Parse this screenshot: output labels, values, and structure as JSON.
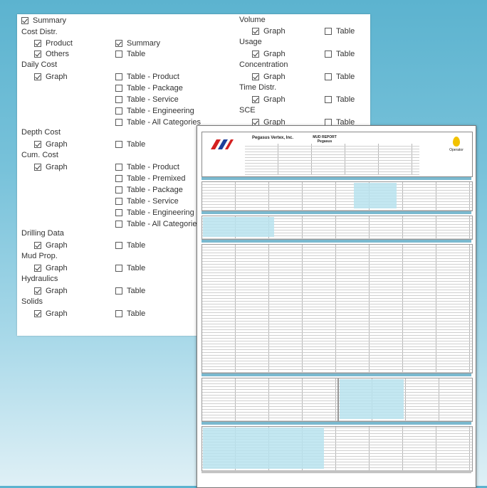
{
  "options": {
    "top_summary": {
      "label": "Summary",
      "checked": true
    },
    "cost_distr": {
      "title": "Cost Distr.",
      "product": {
        "label": "Product",
        "checked": true
      },
      "others": {
        "label": "Others",
        "checked": true
      },
      "summary": {
        "label": "Summary",
        "checked": true
      },
      "table": {
        "label": "Table",
        "checked": false
      }
    },
    "daily_cost": {
      "title": "Daily Cost",
      "graph": {
        "label": "Graph",
        "checked": true
      },
      "tables": [
        {
          "label": "Table - Product",
          "checked": false
        },
        {
          "label": "Table - Package",
          "checked": false
        },
        {
          "label": "Table - Service",
          "checked": false
        },
        {
          "label": "Table - Engineering",
          "checked": false
        },
        {
          "label": "Table - All Categories",
          "checked": false
        }
      ]
    },
    "depth_cost": {
      "title": "Depth Cost",
      "graph": {
        "label": "Graph",
        "checked": true
      },
      "table": {
        "label": "Table",
        "checked": false
      }
    },
    "cum_cost": {
      "title": "Cum. Cost",
      "graph": {
        "label": "Graph",
        "checked": true
      },
      "tables": [
        {
          "label": "Table - Product",
          "checked": false
        },
        {
          "label": "Table - Premixed",
          "checked": false
        },
        {
          "label": "Table - Package",
          "checked": false
        },
        {
          "label": "Table - Service",
          "checked": false
        },
        {
          "label": "Table - Engineering",
          "checked": false
        },
        {
          "label": "Table - All Categories",
          "checked": false
        }
      ]
    },
    "drilling_data": {
      "title": "Drilling Data",
      "graph": {
        "label": "Graph",
        "checked": true
      },
      "table": {
        "label": "Table",
        "checked": false
      }
    },
    "mud_prop": {
      "title": "Mud Prop.",
      "graph": {
        "label": "Graph",
        "checked": true
      },
      "table": {
        "label": "Table",
        "checked": false
      }
    },
    "hydraulics": {
      "title": "Hydraulics",
      "graph": {
        "label": "Graph",
        "checked": true
      },
      "table": {
        "label": "Table",
        "checked": false
      }
    },
    "solids": {
      "title": "Solids",
      "graph": {
        "label": "Graph",
        "checked": true
      },
      "table": {
        "label": "Table",
        "checked": false
      }
    },
    "volume": {
      "title": "Volume",
      "graph": {
        "label": "Graph",
        "checked": true
      },
      "table": {
        "label": "Table",
        "checked": false
      }
    },
    "usage": {
      "title": "Usage",
      "graph": {
        "label": "Graph",
        "checked": true
      },
      "table": {
        "label": "Table",
        "checked": false
      }
    },
    "concentration": {
      "title": "Concentration",
      "graph": {
        "label": "Graph",
        "checked": true
      },
      "table": {
        "label": "Table",
        "checked": false
      }
    },
    "time_distr": {
      "title": "Time Distr.",
      "graph": {
        "label": "Graph",
        "checked": true
      },
      "table": {
        "label": "Table",
        "checked": false
      }
    },
    "sce": {
      "title": "SCE",
      "graph": {
        "label": "Graph",
        "checked": true
      },
      "table": {
        "label": "Table",
        "checked": false
      }
    }
  },
  "report": {
    "company": "Pegasus Vertex, Inc.",
    "title_line1": "MUD REPORT",
    "title_line2": "Pegasus",
    "operator_label": "Operator",
    "colors": {
      "accent": "#7ab9cf",
      "cyan": "#b9e3ee",
      "logo_red": "#d42020",
      "logo_blue": "#1d3f9a",
      "operator_drop": "#f2c200"
    }
  }
}
